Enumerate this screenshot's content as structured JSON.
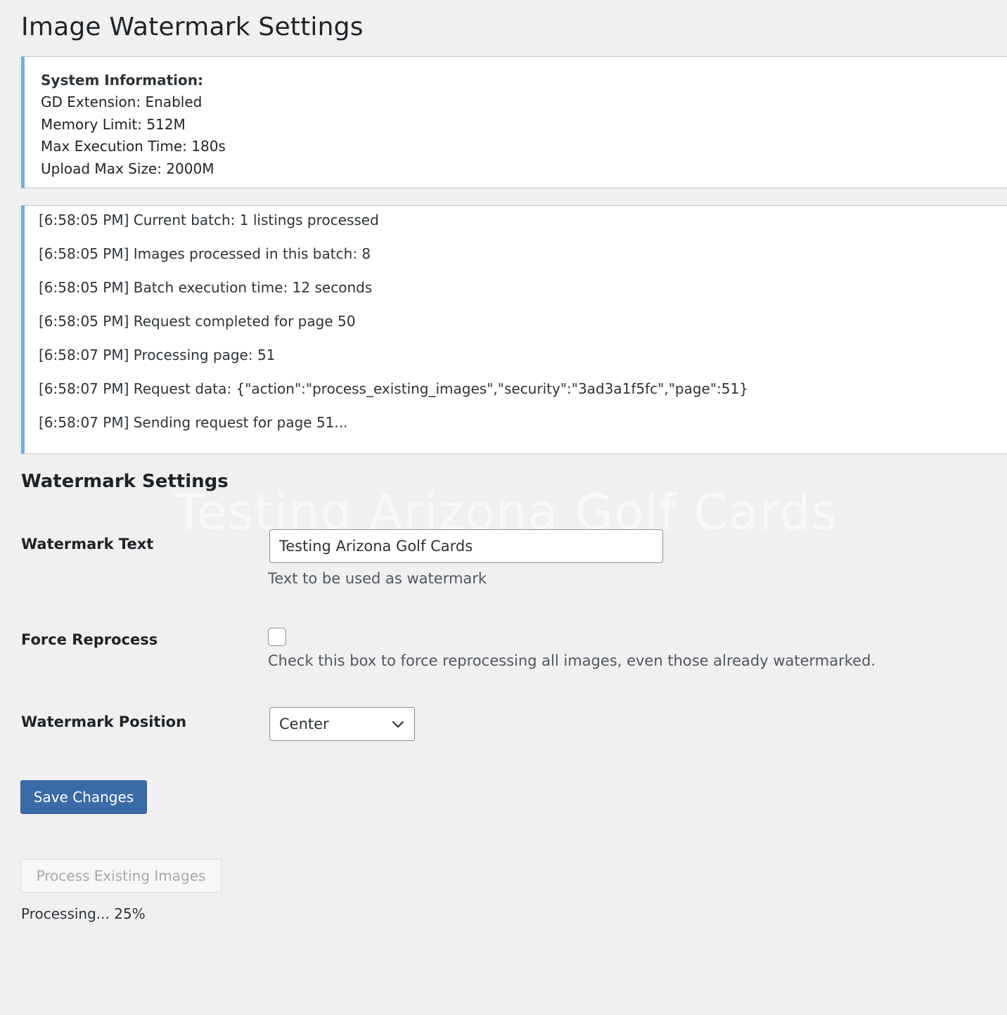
{
  "page": {
    "title": "Image Watermark Settings"
  },
  "system_info": {
    "heading": "System Information:",
    "lines": [
      "GD Extension: Enabled",
      "Memory Limit: 512M",
      "Max Execution Time: 180s",
      "Upload Max Size: 2000M"
    ]
  },
  "log": {
    "entries": [
      "[6:58:05 PM] Current batch: 1 listings processed",
      "[6:58:05 PM] Images processed in this batch: 8",
      "[6:58:05 PM] Batch execution time: 12 seconds",
      "[6:58:05 PM] Request completed for page 50",
      "[6:58:07 PM] Processing page: 51",
      "[6:58:07 PM] Request data: {\"action\":\"process_existing_images\",\"security\":\"3ad3a1f5fc\",\"page\":51}",
      "[6:58:07 PM] Sending request for page 51..."
    ]
  },
  "settings": {
    "section_title": "Watermark Settings",
    "watermark_overlay": "Testing Arizona Golf Cards",
    "watermark_text": {
      "label": "Watermark Text",
      "value": "Testing Arizona Golf Cards",
      "description": "Text to be used as watermark"
    },
    "force_reprocess": {
      "label": "Force Reprocess",
      "checked": false,
      "description": "Check this box to force reprocessing all images, even those already watermarked."
    },
    "watermark_position": {
      "label": "Watermark Position",
      "selected": "Center"
    }
  },
  "actions": {
    "save_label": "Save Changes",
    "process_label": "Process Existing Images",
    "progress_text": "Processing... 25%",
    "progress_percent": 25
  },
  "colors": {
    "accent_border": "#72aee6",
    "primary_button": "#3a6aa8",
    "background": "#f0f0f1"
  },
  "icons": {
    "select_chevron": "chevron-down-icon"
  }
}
